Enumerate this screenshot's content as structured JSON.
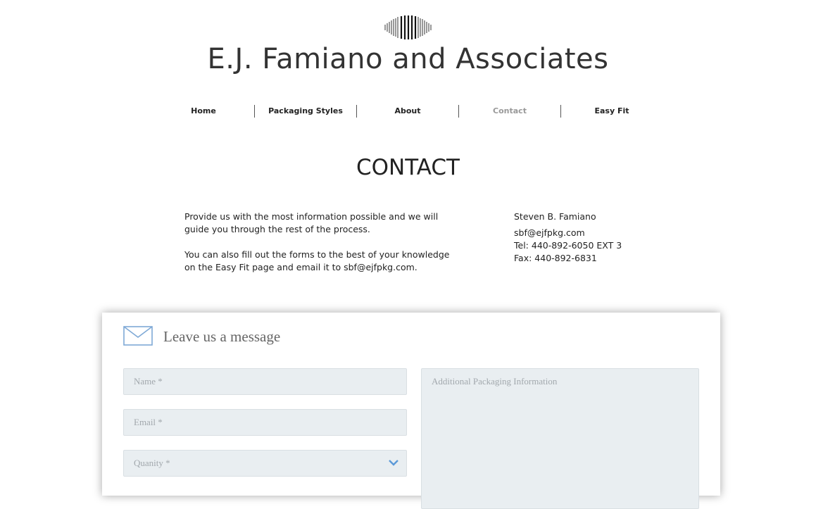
{
  "site": {
    "title": "E.J. Famiano and Associates",
    "logo_icon": "barcode-logo-icon"
  },
  "nav": {
    "items": [
      {
        "label": "Home"
      },
      {
        "label": "Packaging Styles"
      },
      {
        "label": "About"
      },
      {
        "label": "Contact",
        "current": true
      },
      {
        "label": "Easy Fit"
      }
    ],
    "current_color": "#999999"
  },
  "page": {
    "heading": "CONTACT",
    "intro_p1": "Provide us with the most information possible and we will guide you through the rest of the process.",
    "intro_p2": "You can also fill out the forms to the best of your knowledge on the Easy Fit page and email it to sbf@ejfpkg.com."
  },
  "contact": {
    "name": "Steven B. Famiano",
    "email": "sbf@ejfpkg.com",
    "tel": "Tel: 440-892-6050 EXT 3",
    "fax": "Fax: 440-892-6831"
  },
  "form": {
    "title": "Leave us a message",
    "icon": "envelope-icon",
    "name_placeholder": "Name *",
    "email_placeholder": "Email *",
    "quantity_placeholder": "Quanity *",
    "info_placeholder": "Additional Packaging Information",
    "field_bg": "#e9eef1",
    "accent": "#4a90d9"
  }
}
